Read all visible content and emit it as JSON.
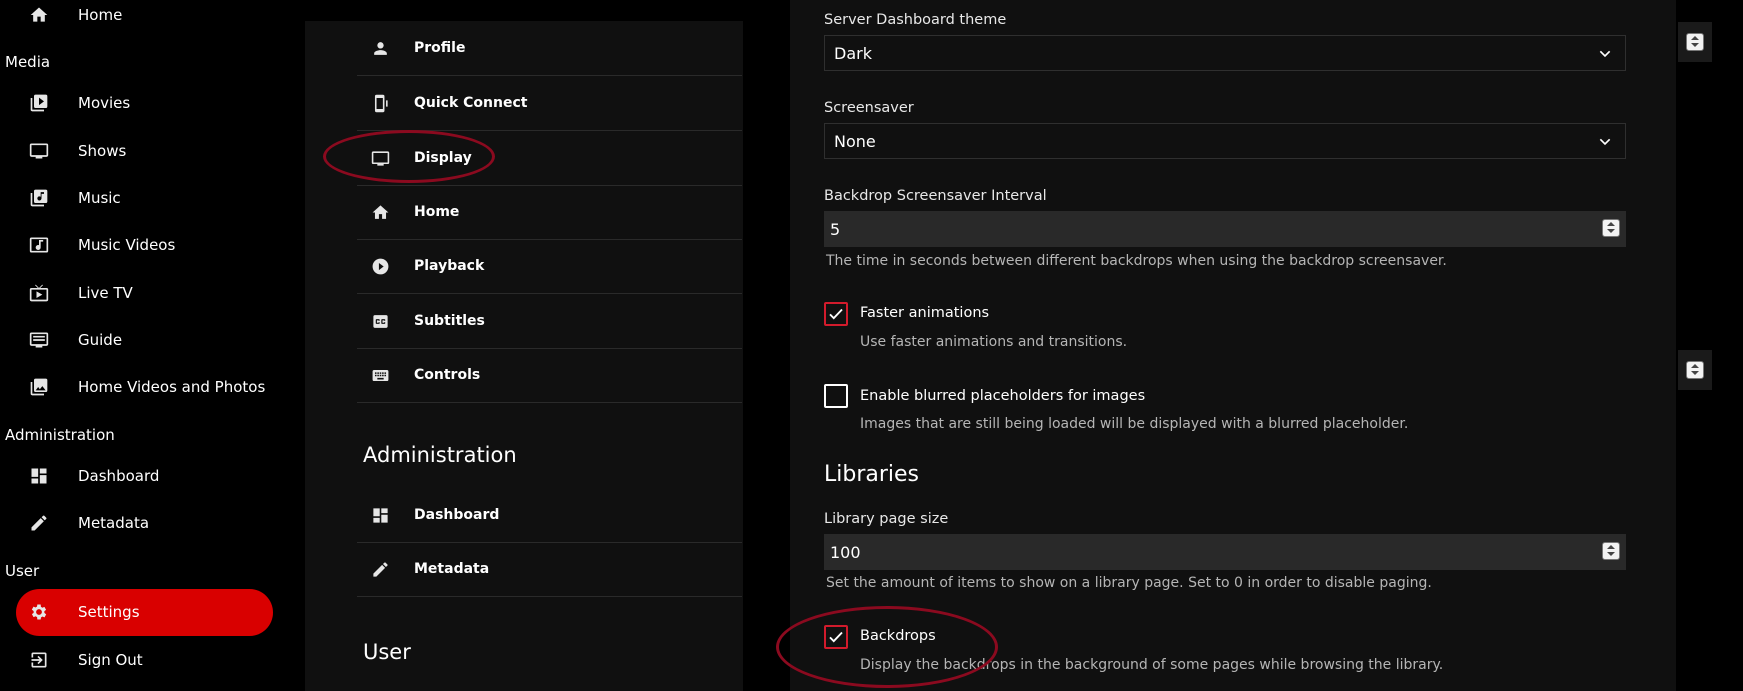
{
  "nav": {
    "home": "Home",
    "media_heading": "Media",
    "media": [
      "Movies",
      "Shows",
      "Music",
      "Music Videos",
      "Live TV",
      "Guide",
      "Home Videos and Photos"
    ],
    "admin_heading": "Administration",
    "admin": [
      "Dashboard",
      "Metadata"
    ],
    "user_heading": "User",
    "settings": "Settings",
    "signout": "Sign Out",
    "active_color": "#d90000"
  },
  "menu": {
    "items": [
      "Profile",
      "Quick Connect",
      "Display",
      "Home",
      "Playback",
      "Subtitles",
      "Controls"
    ],
    "admin_heading": "Administration",
    "admin_items": [
      "Dashboard",
      "Metadata"
    ],
    "user_heading": "User"
  },
  "panel": {
    "dashboard_theme_label": "Server Dashboard theme",
    "dashboard_theme_value": "Dark",
    "screensaver_label": "Screensaver",
    "screensaver_value": "None",
    "interval_label": "Backdrop Screensaver Interval",
    "interval_value": "5",
    "interval_help": "The time in seconds between different backdrops when using the backdrop screensaver.",
    "faster_label": "Faster animations",
    "faster_help": "Use faster animations and transitions.",
    "faster_checked": true,
    "blur_label": "Enable blurred placeholders for images",
    "blur_help": "Images that are still being loaded will be displayed with a blurred placeholder.",
    "blur_checked": false,
    "libraries_heading": "Libraries",
    "page_size_label": "Library page size",
    "page_size_value": "100",
    "page_size_help": "Set the amount of items to show on a library page. Set to 0 in order to disable paging.",
    "backdrops_label": "Backdrops",
    "backdrops_help": "Display the backdrops in the background of some pages while browsing the library.",
    "backdrops_checked": true
  },
  "annotation_color": "#8b0a1f"
}
